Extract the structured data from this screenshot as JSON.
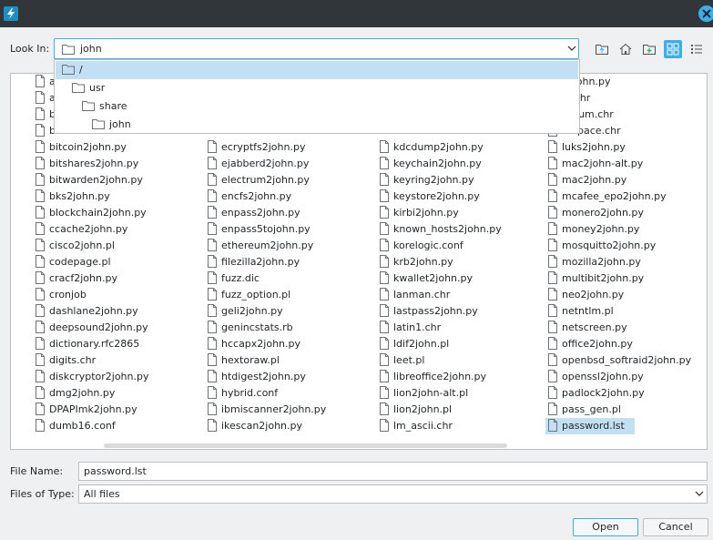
{
  "look_in": {
    "label": "Look In:",
    "value": "john"
  },
  "path_dropdown": [
    {
      "label": "/",
      "selected": true
    },
    {
      "label": "usr",
      "selected": false
    },
    {
      "label": "share",
      "selected": false
    },
    {
      "label": "john",
      "selected": false
    }
  ],
  "toolbar": {
    "up_icon": "folder-up-icon",
    "home_icon": "home-icon",
    "new_folder_icon": "new-folder-icon",
    "grid_view_icon": "grid-view-icon",
    "list_view_icon": "list-view-icon"
  },
  "columns": [
    [
      "a",
      "a",
      "b",
      "b",
      "bitcoin2john.py",
      "bitshares2john.py",
      "bitwarden2john.py",
      "bks2john.py",
      "blockchain2john.py",
      "ccache2john.py",
      "cisco2john.pl",
      "codepage.pl",
      "cracf2john.py",
      "cronjob",
      "dashlane2john.py",
      "deepsound2john.py",
      "dictionary.rfc2865",
      "digits.chr",
      "diskcryptor2john.py",
      "dmg2john.py",
      "DPAPImk2john.py",
      "dumb16.conf"
    ],
    [
      "",
      "",
      "",
      "",
      "ecryptfs2john.py",
      "ejabberd2john.py",
      "electrum2john.py",
      "encfs2john.py",
      "enpass2john.py",
      "enpass5tojohn.py",
      "ethereum2john.py",
      "filezilla2john.py",
      "fuzz.dic",
      "fuzz_option.pl",
      "geli2john.py",
      "genincstats.rb",
      "hccapx2john.py",
      "hextoraw.pl",
      "htdigest2john.py",
      "hybrid.conf",
      "ibmiscanner2john.py",
      "ikescan2john.py"
    ],
    [
      "",
      "",
      "",
      "",
      "kdcdump2john.py",
      "keychain2john.py",
      "keyring2john.py",
      "keystore2john.py",
      "kirbi2john.py",
      "known_hosts2john.py",
      "korelogic.conf",
      "krb2john.py",
      "kwallet2john.py",
      "lanman.chr",
      "lastpass2john.py",
      "latin1.chr",
      "ldif2john.pl",
      "leet.pl",
      "libreoffice2john.py",
      "lion2john-alt.pl",
      "lion2john.pl",
      "lm_ascii.chr"
    ],
    [
      "s2john.py",
      "er.chr",
      "ernum.chr",
      "erspace.chr",
      "luks2john.py",
      "mac2john-alt.py",
      "mac2john.py",
      "mcafee_epo2john.py",
      "monero2john.py",
      "money2john.py",
      "mosquitto2john.py",
      "mozilla2john.py",
      "multibit2john.py",
      "neo2john.py",
      "netntlm.pl",
      "netscreen.py",
      "office2john.py",
      "openbsd_softraid2john.py",
      "openssl2john.py",
      "padlock2john.py",
      "pass_gen.pl",
      "password.lst"
    ]
  ],
  "selected_file": "password.lst",
  "file_name": {
    "label": "File Name:",
    "value": "password.lst"
  },
  "file_type": {
    "label": "Files of Type:",
    "value": "All files"
  },
  "buttons": {
    "open": "Open",
    "cancel": "Cancel"
  },
  "colors": {
    "accent": "#3daee9",
    "titlebar": "#31363b",
    "selection": "#c2e0f4"
  }
}
